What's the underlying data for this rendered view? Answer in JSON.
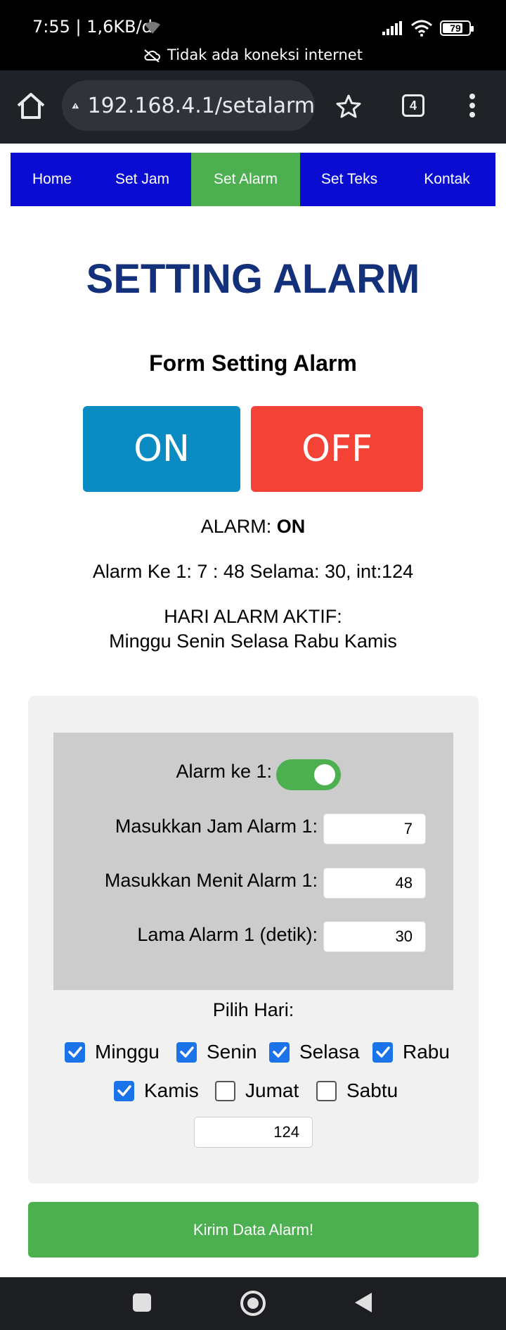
{
  "status_bar": {
    "time_speed": "7:55 | 1,6KB/d",
    "battery": "79",
    "battery_level": 0.79,
    "notice": "Tidak ada koneksi internet"
  },
  "browser": {
    "url": "192.168.4.1/setalarm",
    "tab_count": "4"
  },
  "nav": {
    "items": [
      {
        "label": "Home"
      },
      {
        "label": "Set Jam"
      },
      {
        "label": "Set Alarm"
      },
      {
        "label": "Set Teks"
      },
      {
        "label": "Kontak"
      }
    ],
    "active": "Set Alarm",
    "colors": {
      "background": "#0a0dd1",
      "active": "#4caf50"
    }
  },
  "page": {
    "title": "SETTING ALARM",
    "form_heading": "Form Setting Alarm",
    "btn_on": "ON",
    "btn_off": "OFF",
    "alarm_status_label": "ALARM:",
    "alarm_status_value": "ON",
    "alarm_detail": "Alarm Ke 1: 7 : 48 Selama: 30, int:124",
    "active_days_title": "HARI ALARM AKTIF:",
    "active_days_list": "Minggu Senin Selasa Rabu Kamis"
  },
  "form": {
    "alarm_toggle_label": "Alarm ke 1:",
    "alarm_enabled": true,
    "hour_label": "Masukkan Jam Alarm 1:",
    "hour_value": "7",
    "minute_label": "Masukkan Menit Alarm 1:",
    "minute_value": "48",
    "duration_label": "Lama Alarm 1 (detik):",
    "duration_value": "30",
    "days_label": "Pilih Hari:",
    "days": [
      {
        "label": "Minggu",
        "checked": true
      },
      {
        "label": "Senin",
        "checked": true
      },
      {
        "label": "Selasa",
        "checked": true
      },
      {
        "label": "Rabu",
        "checked": true
      },
      {
        "label": "Kamis",
        "checked": true
      },
      {
        "label": "Jumat",
        "checked": false
      },
      {
        "label": "Sabtu",
        "checked": false
      }
    ],
    "int_value": "124",
    "submit_label": "Kirim Data Alarm!"
  }
}
